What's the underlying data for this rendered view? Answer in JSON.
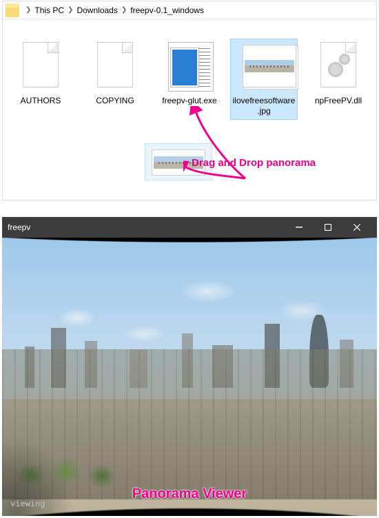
{
  "breadcrumb": {
    "root": "This PC",
    "folder1": "Downloads",
    "folder2": "freepv-0.1_windows"
  },
  "files": {
    "authors": "AUTHORS",
    "copying": "COPYING",
    "exe": "freepv-glut.exe",
    "jpg": "ilovefreesoftware.jpg",
    "dll": "npFreePV.dll"
  },
  "annotation": {
    "drag": "Drag and Drop panorama"
  },
  "viewer": {
    "title": "freepv",
    "status": "viewing",
    "label": "Panorama Viewer"
  },
  "colors": {
    "accent_pink": "#ec008c",
    "selection": "#cce8ff",
    "titlebar": "#3c3c3c"
  }
}
